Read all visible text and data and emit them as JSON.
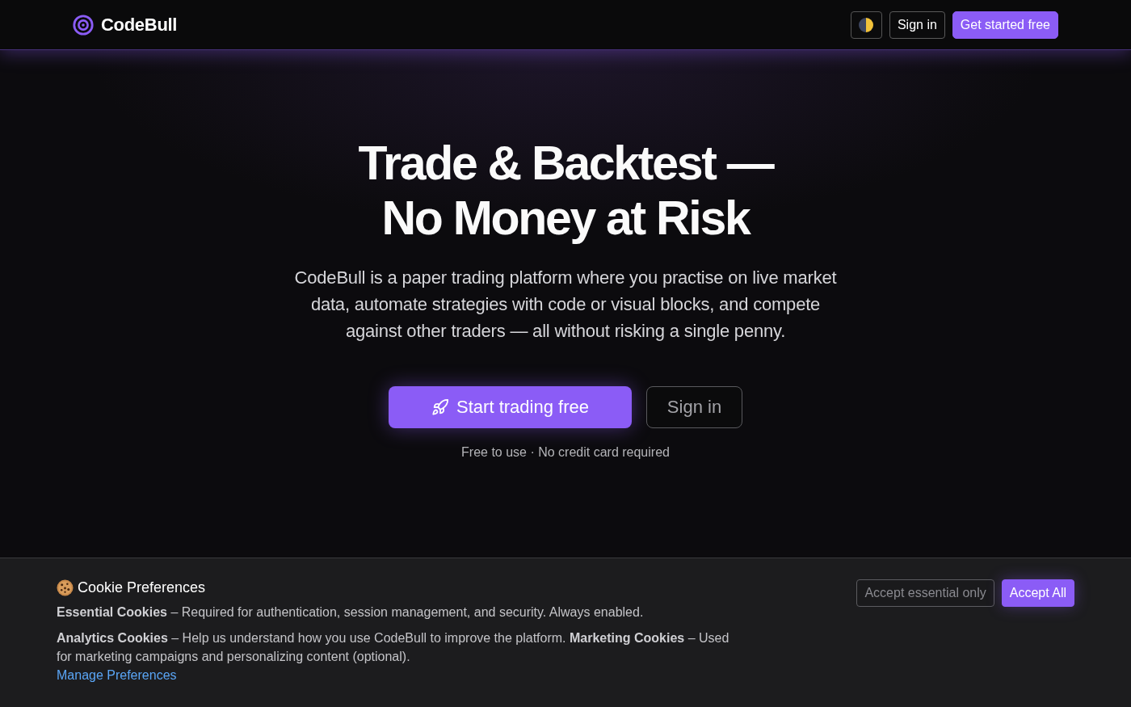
{
  "header": {
    "brand": "CodeBull",
    "buttons": [
      {
        "label": "Sign in",
        "kind": "outline"
      },
      {
        "label": "Get started free",
        "kind": "primary"
      }
    ]
  },
  "hero": {
    "title": "Trade & Backtest — No Money at Risk",
    "subtitle": "CodeBull is a paper trading platform where you practise on live market data, automate strategies with code or visual blocks, and compete against other traders — all without risking a single penny.",
    "buttons": [
      {
        "label": "Start trading free",
        "kind": "primary"
      },
      {
        "label": "Sign in",
        "kind": "outline"
      }
    ],
    "note": "Free to use · No credit card required"
  },
  "cookie_banner": {
    "title": "Cookie Preferences",
    "paragraphs": [
      "**Essential Cookies** – Required for authentication, session management, and security. Always enabled.",
      "**Analytics Cookies** – Help us understand how you use CodeBull to improve the platform. **Marketing Cookies** – Used for marketing campaigns and personalizing content (optional)."
    ],
    "link": "Manage Preferences",
    "buttons": [
      {
        "label": "Accept essential only",
        "kind": "outline"
      },
      {
        "label": "Accept All",
        "kind": "primary"
      }
    ]
  }
}
